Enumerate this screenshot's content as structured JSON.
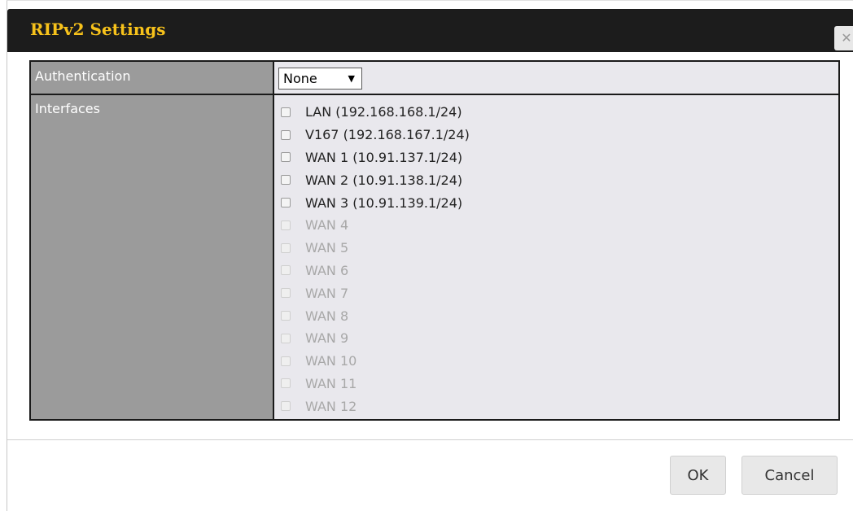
{
  "dialog": {
    "title": "RIPv2 Settings",
    "close_icon": "close-icon"
  },
  "form": {
    "authentication_label": "Authentication",
    "authentication_value": "None",
    "interfaces_label": "Interfaces"
  },
  "interfaces": [
    {
      "label": "LAN (192.168.168.1/24)",
      "enabled": true,
      "checked": false
    },
    {
      "label": "V167 (192.168.167.1/24)",
      "enabled": true,
      "checked": false
    },
    {
      "label": "WAN 1 (10.91.137.1/24)",
      "enabled": true,
      "checked": false
    },
    {
      "label": "WAN 2 (10.91.138.1/24)",
      "enabled": true,
      "checked": false
    },
    {
      "label": "WAN 3 (10.91.139.1/24)",
      "enabled": true,
      "checked": false
    },
    {
      "label": "WAN 4",
      "enabled": false,
      "checked": false
    },
    {
      "label": "WAN 5",
      "enabled": false,
      "checked": false
    },
    {
      "label": "WAN 6",
      "enabled": false,
      "checked": false
    },
    {
      "label": "WAN 7",
      "enabled": false,
      "checked": false
    },
    {
      "label": "WAN 8",
      "enabled": false,
      "checked": false
    },
    {
      "label": "WAN 9",
      "enabled": false,
      "checked": false
    },
    {
      "label": "WAN 10",
      "enabled": false,
      "checked": false
    },
    {
      "label": "WAN 11",
      "enabled": false,
      "checked": false
    },
    {
      "label": "WAN 12",
      "enabled": false,
      "checked": false
    }
  ],
  "buttons": {
    "ok_label": "OK",
    "cancel_label": "Cancel"
  },
  "colors": {
    "title_text": "#f7c21b",
    "titlebar_bg": "#1c1c1c",
    "label_col_bg": "#9b9b9b",
    "value_col_bg": "#e9e8ed"
  }
}
